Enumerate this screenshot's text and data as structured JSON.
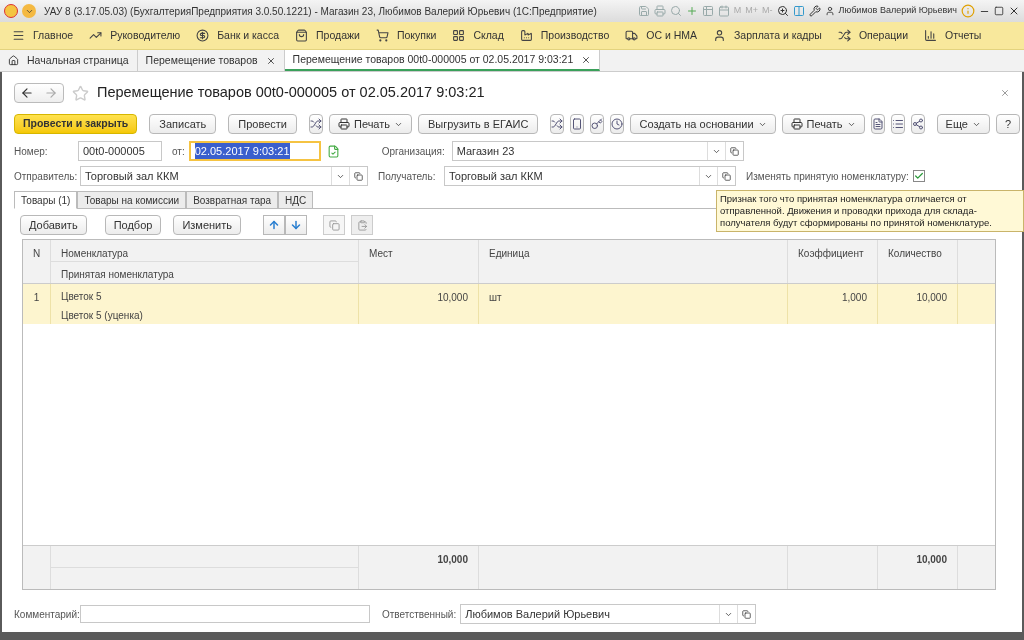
{
  "title_bar": {
    "title": "УАУ 8 (3.17.05.03) (БухгалтерияПредприятия 3.0.50.1221) - Магазин 23, Любимов Валерий Юрьевич  (1С:Предприятие)",
    "memory_keys": [
      "M",
      "M+",
      "M-"
    ],
    "user": "Любимов Валерий Юрьевич"
  },
  "sections": [
    {
      "label": "Главное"
    },
    {
      "label": "Руководителю"
    },
    {
      "label": "Банк и касса"
    },
    {
      "label": "Продажи"
    },
    {
      "label": "Покупки"
    },
    {
      "label": "Склад"
    },
    {
      "label": "Производство"
    },
    {
      "label": "ОС и НМА"
    },
    {
      "label": "Зарплата и кадры"
    },
    {
      "label": "Операции"
    },
    {
      "label": "Отчеты"
    }
  ],
  "open_tabs": [
    {
      "kind": "home",
      "label": "Начальная страница",
      "selected": false
    },
    {
      "kind": "page",
      "label": "Перемещение товаров",
      "selected": false
    },
    {
      "kind": "page",
      "label": "Перемещение товаров 00t0-000005 от 02.05.2017 9:03:21",
      "selected": true
    }
  ],
  "form": {
    "title": "Перемещение товаров 00t0-000005 от 02.05.2017 9:03:21",
    "toolbar": [
      {
        "kind": "primary",
        "label": "Провести и закрыть"
      },
      {
        "kind": "button",
        "label": "Записать"
      },
      {
        "kind": "button",
        "label": "Провести"
      },
      {
        "kind": "icon"
      },
      {
        "kind": "menu",
        "label": "Печать"
      },
      {
        "kind": "button",
        "label": "Выгрузить в ЕГАИС"
      },
      {
        "kind": "icon"
      },
      {
        "kind": "icon"
      },
      {
        "kind": "icon"
      },
      {
        "kind": "icon"
      },
      {
        "kind": "menu",
        "label": "Создать на основании"
      },
      {
        "kind": "menu",
        "label": "Печать"
      },
      {
        "kind": "icon"
      },
      {
        "kind": "icon"
      },
      {
        "kind": "icon"
      }
    ],
    "more_button": "Еще",
    "help_button": "?",
    "number": {
      "label": "Номер:",
      "value": "00t0-000005"
    },
    "date": {
      "label": "от:",
      "value": "02.05.2017  9:03:21",
      "selected": true
    },
    "organization": {
      "label": "Организация:",
      "value": "Магазин 23"
    },
    "sender": {
      "label": "Отправитель:",
      "value": "Торговый зал ККМ"
    },
    "recipient": {
      "label": "Получатель:",
      "value": "Торговый зал ККМ"
    },
    "change_accepted": {
      "label": "Изменять принятую номенклатуру:",
      "checked": true
    },
    "tooltip": "Признак того что принятая номенклатура отличается от отправленной. Движения и проводки прихода для склада-получателя будут сформированы по принятой номенклатуре.",
    "tabs": [
      {
        "label": "Товары (1)",
        "selected": true
      },
      {
        "label": "Товары на комиссии",
        "selected": false
      },
      {
        "label": "Возвратная тара",
        "selected": false
      },
      {
        "label": "НДС",
        "selected": false
      }
    ],
    "table_buttons": [
      "Добавить",
      "Подбор",
      "Изменить"
    ],
    "table": {
      "columns": [
        "N",
        "Номенклатура",
        "Мест",
        "Единица",
        "Коэффициент",
        "Количество"
      ],
      "subcolumn": "Принятая номенклатура",
      "rows": [
        {
          "n": "1",
          "item": "Цветок 5",
          "accepted_item": "Цветок 5 (уценка)",
          "places": "10,000",
          "unit": "шт",
          "factor": "1,000",
          "quantity": "10,000",
          "selected": true
        }
      ],
      "totals": {
        "places": "10,000",
        "quantity": "10,000"
      }
    },
    "comment": {
      "label": "Комментарий:"
    },
    "responsible": {
      "label": "Ответственный:",
      "value": "Любимов Валерий Юрьевич"
    }
  }
}
